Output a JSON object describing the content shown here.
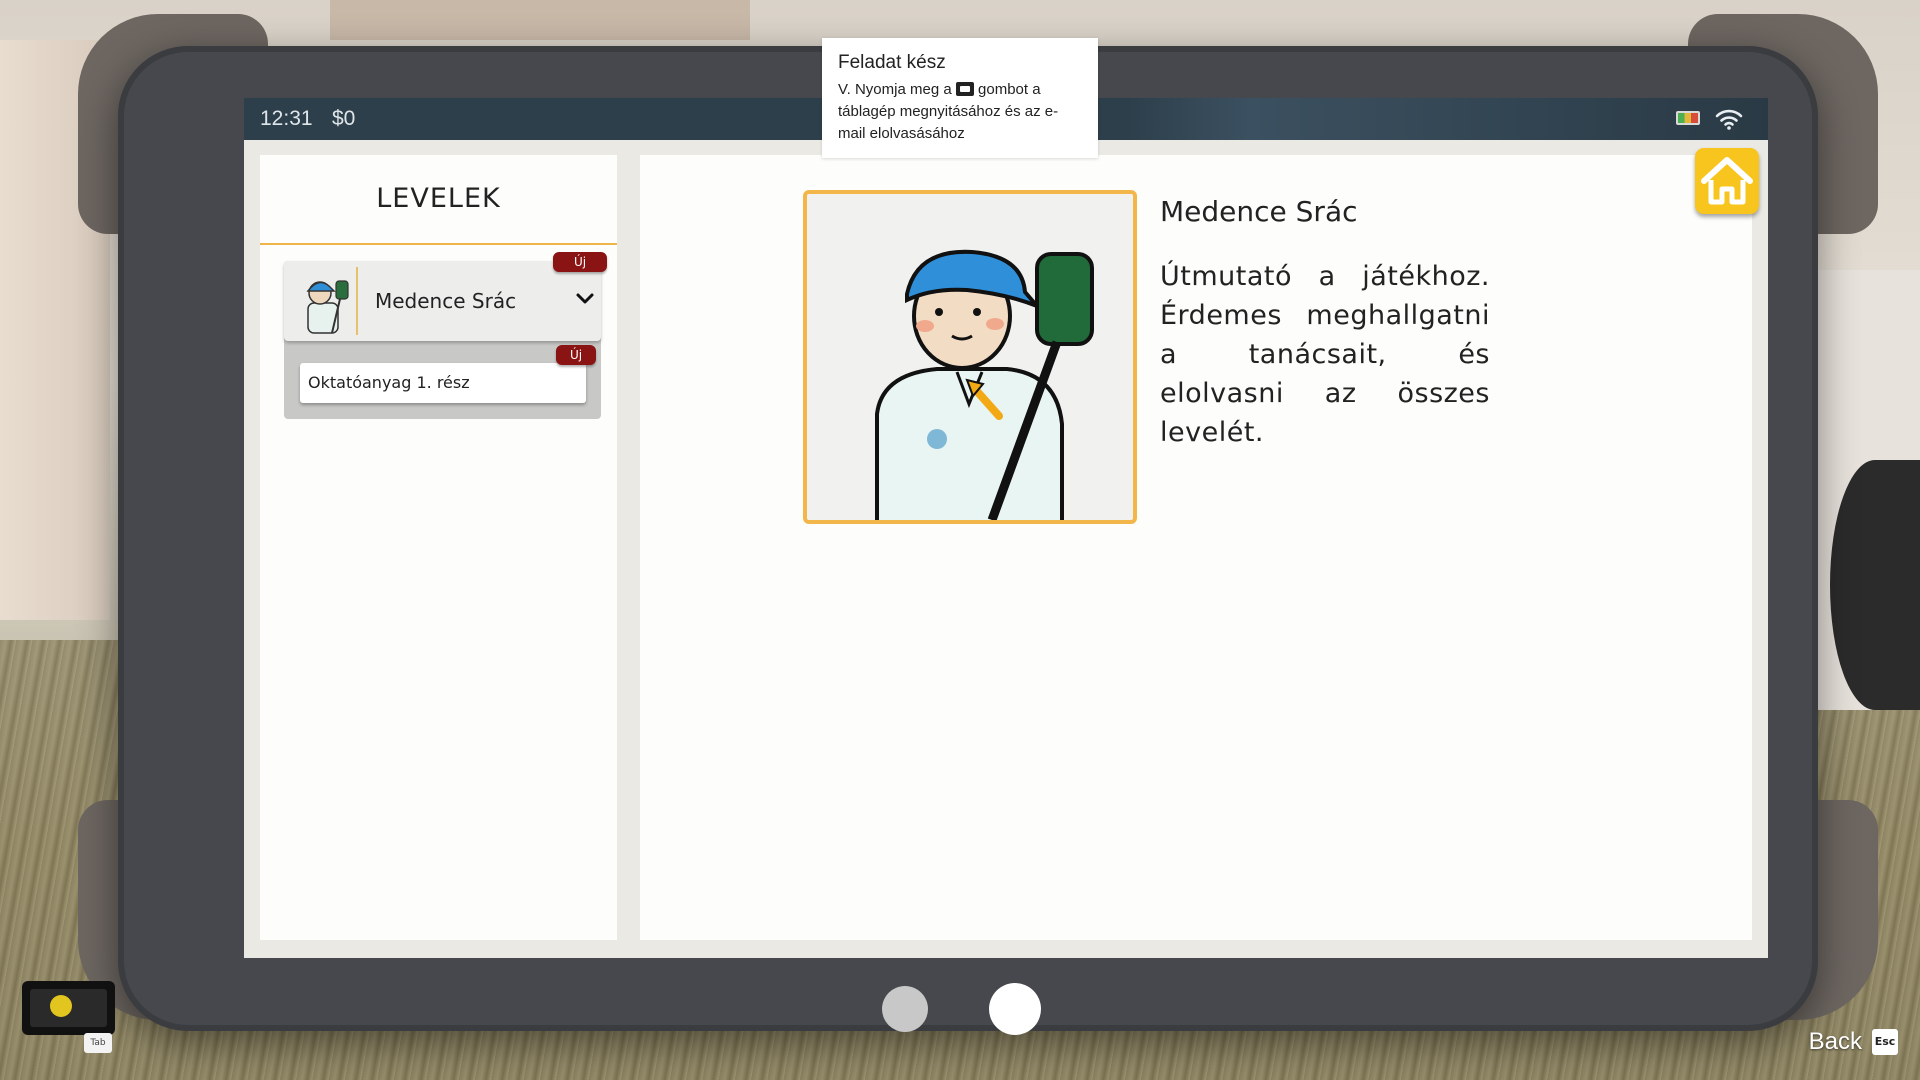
{
  "status_bar": {
    "time": "12:31",
    "money": "$0"
  },
  "mail_list": {
    "title": "LEVELEK",
    "senders": [
      {
        "name": "Medence Srác",
        "badge": "Új",
        "items": [
          {
            "subject": "Oktatóanyag 1. rész",
            "badge": "Új"
          }
        ]
      }
    ]
  },
  "mail_detail": {
    "sender_name": "Medence Srác",
    "body": "Útmutató a játékhoz. Érdemes meghallgatni a tanácsait, és elolvasni az összes levelét."
  },
  "notification": {
    "title": "Feladat kész",
    "text_before_icon": "V. Nyomja meg a",
    "text_after_icon": "gombot a táblagép megnyitásához és az e-mail elolvasásához"
  },
  "controls": {
    "tab_key": "Tab",
    "back_label": "Back",
    "esc_key": "Esc"
  },
  "pagination": {
    "total_pages": 2,
    "active_page": 2
  },
  "colors": {
    "accent": "#f2b64b",
    "badge": "#8a1313",
    "home": "#f7c51d",
    "statusbar": "#2d3f4b"
  }
}
